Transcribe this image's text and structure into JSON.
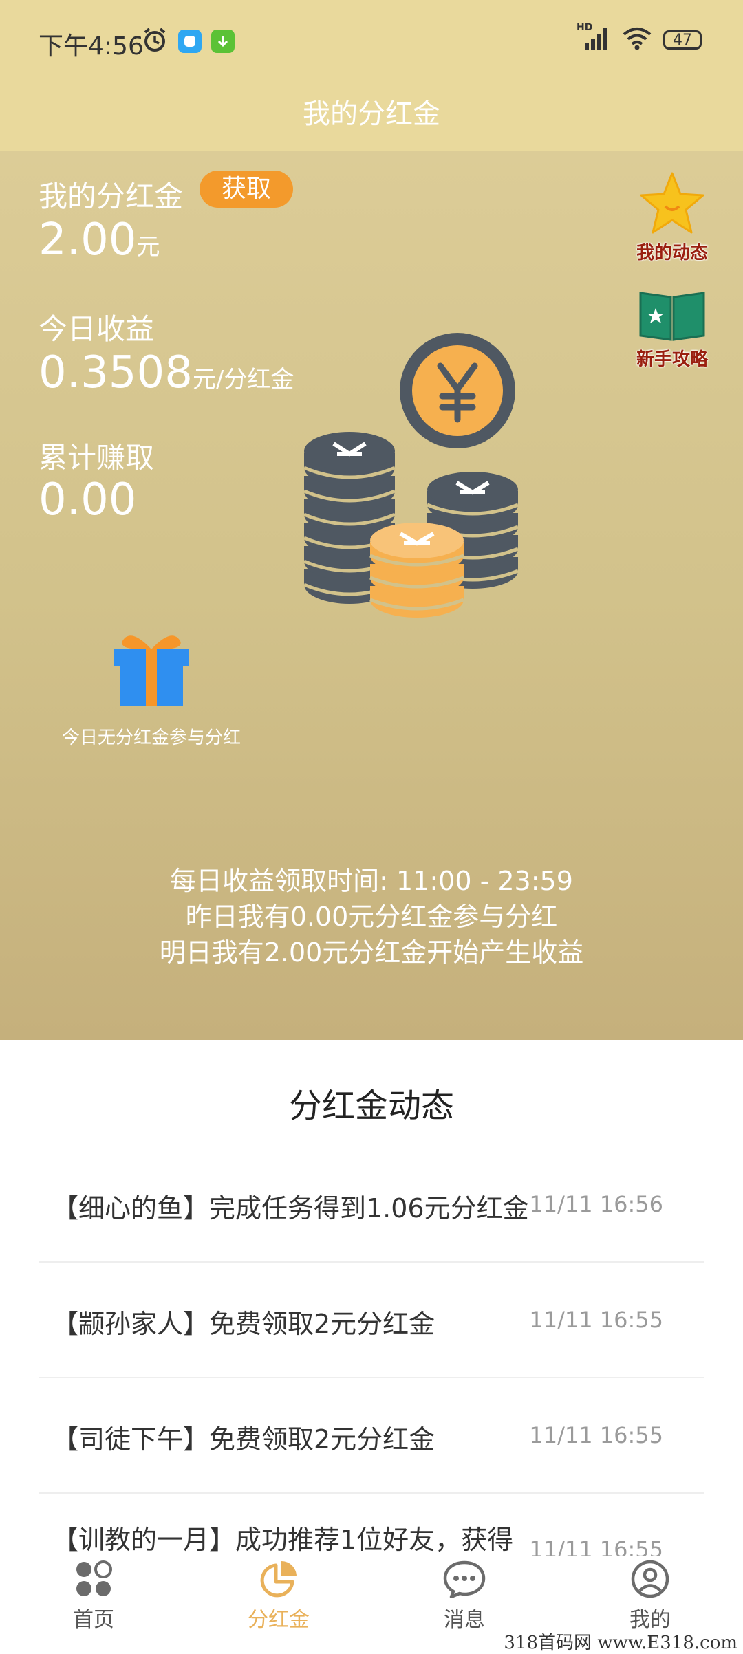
{
  "status_bar": {
    "time": "下午4:56",
    "network": "HD",
    "battery": "47"
  },
  "header": {
    "title": "我的分红金"
  },
  "summary": {
    "dividend_label": "我的分红金",
    "get_button": "获取",
    "dividend_value": "2.00",
    "dividend_unit": "元",
    "today_label": "今日收益",
    "today_value": "0.3508",
    "today_unit": "元/分红金",
    "total_label": "累计赚取",
    "total_value": "0.00"
  },
  "side_links": {
    "my_activity": "我的动态",
    "beginner_guide": "新手攻略"
  },
  "gift": {
    "text": "今日无分红金参与分红"
  },
  "info_lines": [
    "每日收益领取时间: 11:00 - 23:59",
    "昨日我有0.00元分红金参与分红",
    "明日我有2.00元分红金开始产生收益"
  ],
  "feed": {
    "title": "分红金动态",
    "items": [
      {
        "text": "【细心的鱼】完成任务得到1.06元分红金",
        "time": "11/11 16:56"
      },
      {
        "text": "【颛孙家人】免费领取2元分红金",
        "time": "11/11 16:55"
      },
      {
        "text": "【司徒下午】免费领取2元分红金",
        "time": "11/11 16:55"
      },
      {
        "text": "【训教的一月】成功推荐1位好友，获得",
        "time": "11/11 16:55"
      }
    ]
  },
  "bottom_nav": {
    "items": [
      {
        "label": "首页",
        "icon": "home-dots-icon"
      },
      {
        "label": "分红金",
        "icon": "pie-chart-icon"
      },
      {
        "label": "消息",
        "icon": "chat-bubble-icon"
      },
      {
        "label": "我的",
        "icon": "profile-icon"
      }
    ],
    "active_index": 1
  },
  "watermark": "318首码网  www.E318.com",
  "colors": {
    "header_bg": "#e9d99c",
    "accent_orange": "#f39a2c",
    "nav_active": "#e9b15a"
  }
}
